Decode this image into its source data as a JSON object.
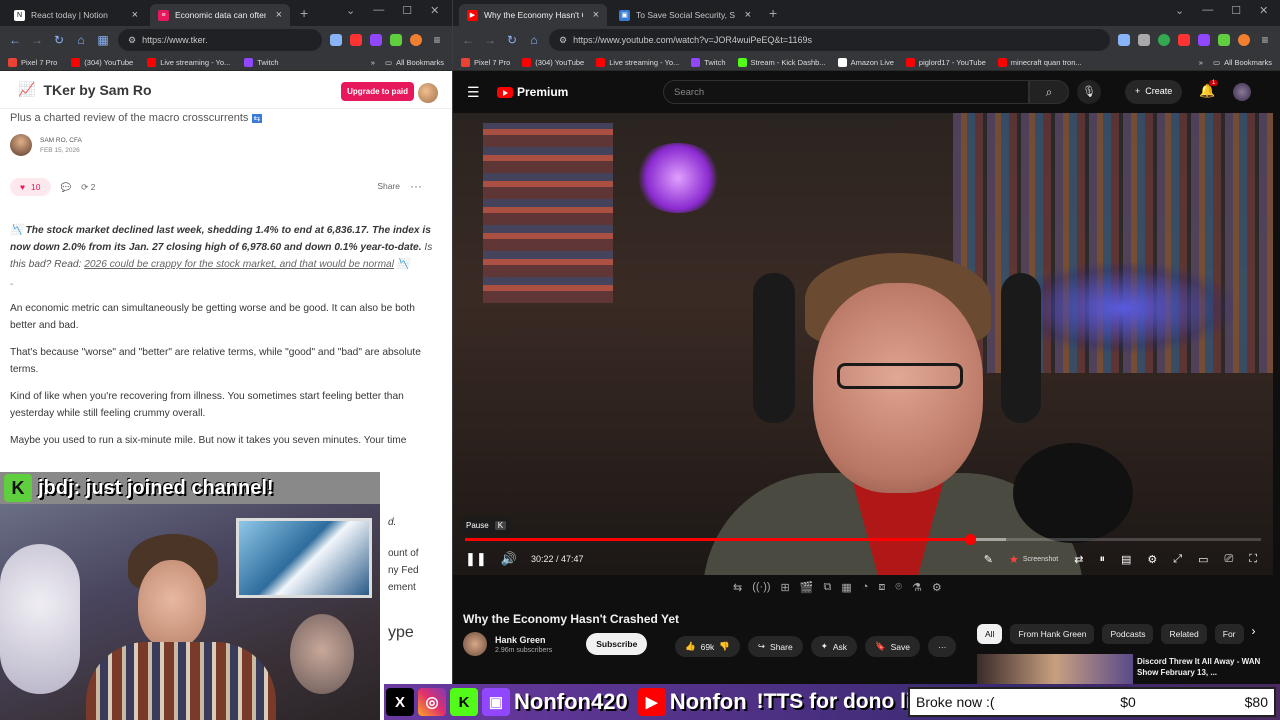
{
  "left_browser": {
    "tabs": [
      {
        "title": "React today | Notion",
        "icon": "notion-icon",
        "icon_color": "#ffffff",
        "active": false
      },
      {
        "title": "Economic data can often be",
        "icon": "substack-icon",
        "icon_color": "#e8185c",
        "active": true
      }
    ],
    "address": "https://www.tker.",
    "bookmarks": [
      {
        "label": "Pixel 7 Pro",
        "color": "#ea4335"
      },
      {
        "label": "(304) YouTube",
        "color": "#ff0000"
      },
      {
        "label": "Live streaming - Yo...",
        "color": "#ff0000"
      },
      {
        "label": "Twitch",
        "color": "#9146ff"
      }
    ],
    "all_bookmarks": "All Bookmarks"
  },
  "right_browser": {
    "tabs": [
      {
        "title": "Why the Economy Hasn't C",
        "icon": "youtube-icon",
        "icon_color": "#ff0000",
        "active": true
      },
      {
        "title": "To Save Social Security, Stop S",
        "icon": "page-icon",
        "icon_color": "#3a7bd5",
        "active": false
      }
    ],
    "address": "https://www.youtube.com/watch?v=JOR4wuiPeEQ&t=1169s",
    "bookmarks": [
      {
        "label": "Pixel 7 Pro",
        "color": "#ea4335"
      },
      {
        "label": "(304) YouTube",
        "color": "#ff0000"
      },
      {
        "label": "Live streaming - Yo...",
        "color": "#ff0000"
      },
      {
        "label": "Twitch",
        "color": "#9146ff"
      },
      {
        "label": "Stream - Kick Dashb...",
        "color": "#53fc18"
      },
      {
        "label": "Amazon Live",
        "color": "#232f3e"
      },
      {
        "label": "piglord17 - YouTube",
        "color": "#ff0000"
      },
      {
        "label": "minecraft quan tron...",
        "color": "#ff0000"
      }
    ],
    "all_bookmarks": "All Bookmarks"
  },
  "substack": {
    "publication": "TKer by Sam Ro",
    "upgrade": "Upgrade to paid",
    "subtitle": "Plus a charted review of the macro crosscurrents",
    "author": "SAM RO, CFA",
    "date": "FEB 15, 2026",
    "likes": "10",
    "restacks": "2",
    "share": "Share",
    "lead_bold": "The stock market declined last week, shedding 1.4% to end at 6,836.17. The index is now down 2.0% from its Jan. 27 closing high of 6,978.60 and down 0.1% year-to-date.",
    "lead_question": "Is this bad? Read:",
    "lead_link": "2026 could be crappy for the stock market, and that would be normal",
    "separator": "-",
    "p1": "An economic metric can simultaneously be getting worse and be good. It can also be both better and bad.",
    "p2": "That's because \"worse\" and \"better\" are relative terms, while \"good\" and \"bad\" are absolute terms.",
    "p3": "Kind of like when you're recovering from illness. You sometimes start feeling better than yesterday while still feeling crummy overall.",
    "p4_partial": "Maybe you used to run a six-minute mile. But now it takes you seven minutes. Your time",
    "fragments": [
      "d.",
      "ount of",
      "ny Fed",
      "ement",
      "ype"
    ]
  },
  "stream_overlay": {
    "chat_user": "jbdj",
    "chat_message": "just joined channel!"
  },
  "youtube": {
    "logo": "Premium",
    "search_placeholder": "Search",
    "create": "Create",
    "notif_count": "1",
    "tooltip": "Pause",
    "tooltip_key": "K",
    "time": "30:22 / 47:47",
    "progress_fraction": 0.635,
    "buffered_fraction": 0.68,
    "screenshot_label": "Screenshot",
    "video_title": "Why the Economy Hasn't Crashed Yet",
    "channel": "Hank Green",
    "subscribers": "2.96m subscribers",
    "subscribe": "Subscribe",
    "likes": "69k",
    "share": "Share",
    "ask": "Ask",
    "save": "Save",
    "chips": [
      "All",
      "From Hank Green",
      "Podcasts",
      "Related",
      "For"
    ],
    "rec_title": "Discord Threw It All Away - WAN Show February 13, ..."
  },
  "banner": {
    "handle1": "Nonfon420",
    "handle2": "Nonfon",
    "tts": "!TTS for dono link",
    "goal_label": "Broke now :(",
    "goal_current": "$0",
    "goal_target": "$80"
  }
}
